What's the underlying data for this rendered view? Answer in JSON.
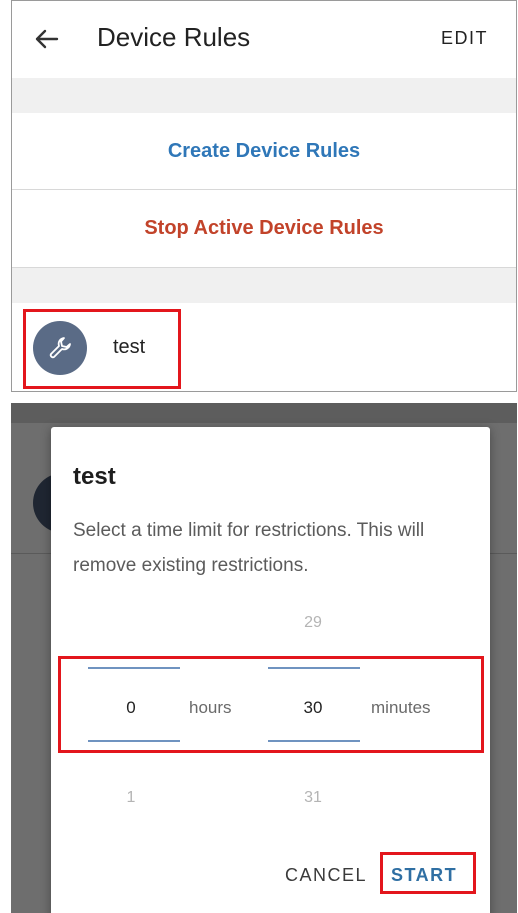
{
  "top": {
    "app_bar": {
      "title": "Device Rules",
      "edit_label": "EDIT"
    },
    "actions": {
      "create_label": "Create Device Rules",
      "stop_label": "Stop Active Device Rules"
    },
    "rule": {
      "name": "test",
      "icon": "wrench-icon"
    }
  },
  "dialog": {
    "title": "test",
    "message": "Select a time limit for restrictions. This will remove existing restrictions.",
    "hours": {
      "prev": "",
      "current": "0",
      "next": "1",
      "unit": "hours"
    },
    "minutes": {
      "prev": "29",
      "current": "30",
      "next": "31",
      "unit": "minutes"
    },
    "cancel_label": "CANCEL",
    "start_label": "START"
  },
  "colors": {
    "link_blue": "#2f77b8",
    "stop_red": "#c2432a",
    "avatar_bg": "#5a6b86",
    "picker_line": "#6f93c0",
    "highlight": "#e3161c"
  }
}
